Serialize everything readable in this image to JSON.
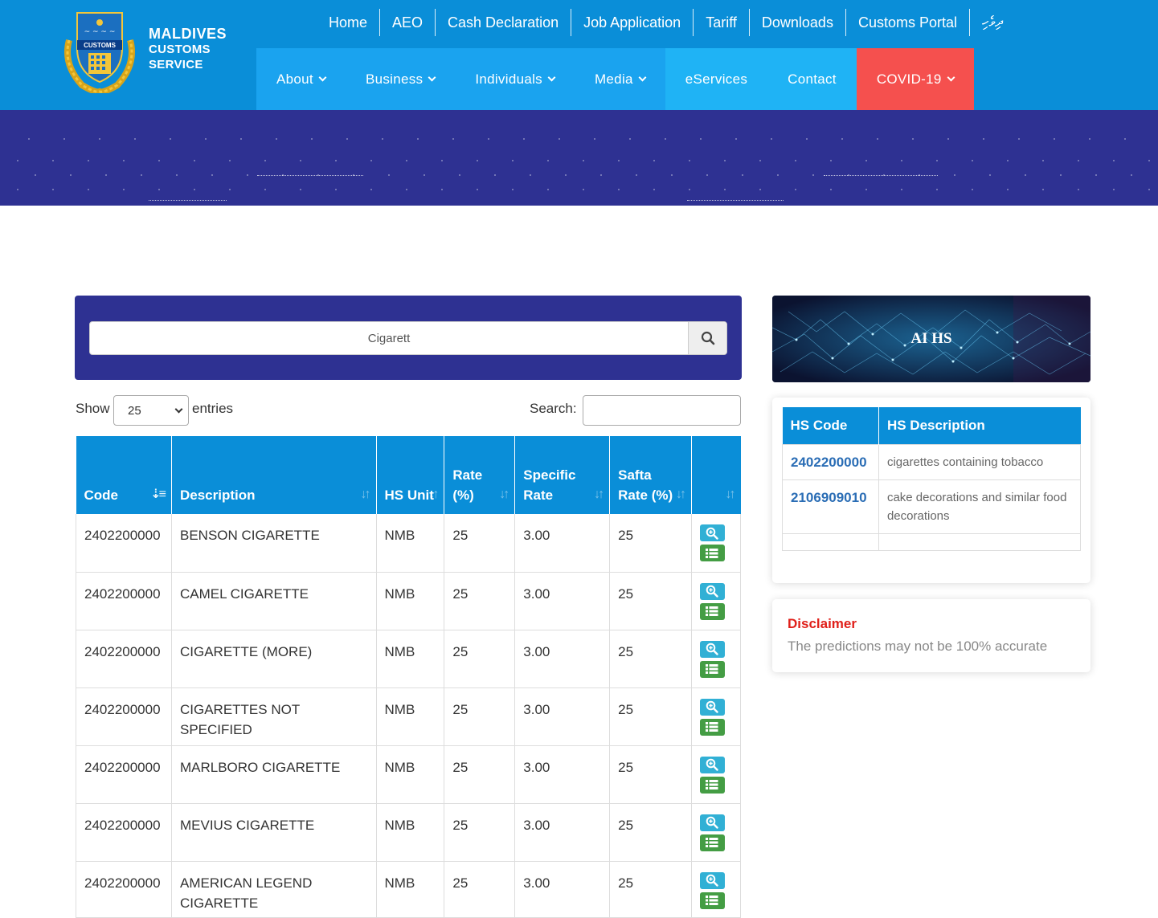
{
  "logo": {
    "line1": "MALDIVES",
    "line2": "CUSTOMS",
    "line3": "SERVICE",
    "badge_text": "CUSTOMS"
  },
  "top_nav": [
    "Home",
    "AEO",
    "Cash Declaration",
    "Job Application",
    "Tariff",
    "Downloads",
    "Customs Portal"
  ],
  "language_link": "ދިވެހި",
  "main_nav": [
    {
      "label": "About",
      "dropdown": true
    },
    {
      "label": "Business",
      "dropdown": true
    },
    {
      "label": "Individuals",
      "dropdown": true
    },
    {
      "label": "Media",
      "dropdown": true
    },
    {
      "label": "eServices",
      "dropdown": false
    },
    {
      "label": "Contact",
      "dropdown": false
    },
    {
      "label": "COVID-19",
      "dropdown": true
    }
  ],
  "search": {
    "value": "Cigarett",
    "icon": "search-icon"
  },
  "controls": {
    "show_label": "Show",
    "page_size": "25",
    "entries_label": "entries",
    "search_label": "Search:"
  },
  "table": {
    "headers": [
      "Code",
      "Description",
      "HS Unit",
      "Rate (%)",
      "Specific Rate",
      "Safta Rate (%)",
      ""
    ],
    "rows": [
      {
        "code": "2402200000",
        "description": "BENSON CIGARETTE",
        "unit": "NMB",
        "rate": "25",
        "specific": "3.00",
        "safta": "25"
      },
      {
        "code": "2402200000",
        "description": "CAMEL CIGARETTE",
        "unit": "NMB",
        "rate": "25",
        "specific": "3.00",
        "safta": "25"
      },
      {
        "code": "2402200000",
        "description": "CIGARETTE (MORE)",
        "unit": "NMB",
        "rate": "25",
        "specific": "3.00",
        "safta": "25"
      },
      {
        "code": "2402200000",
        "description": "CIGARETTES NOT SPECIFIED",
        "unit": "NMB",
        "rate": "25",
        "specific": "3.00",
        "safta": "25"
      },
      {
        "code": "2402200000",
        "description": "MARLBORO CIGARETTE",
        "unit": "NMB",
        "rate": "25",
        "specific": "3.00",
        "safta": "25"
      },
      {
        "code": "2402200000",
        "description": "MEVIUS CIGARETTE",
        "unit": "NMB",
        "rate": "25",
        "specific": "3.00",
        "safta": "25"
      },
      {
        "code": "2402200000",
        "description": "AMERICAN LEGEND CIGARETTE",
        "unit": "NMB",
        "rate": "25",
        "specific": "3.00",
        "safta": "25"
      }
    ]
  },
  "ai_hs": {
    "title": "AI HS",
    "headers": [
      "HS Code",
      "HS Description"
    ],
    "rows": [
      {
        "code": "2402200000",
        "description": "cigarettes containing tobacco"
      },
      {
        "code": "2106909010",
        "description": "cake decorations and similar food decorations"
      }
    ]
  },
  "disclaimer": {
    "title": "Disclaimer",
    "text": "The predictions may not be 100% accurate"
  },
  "colors": {
    "header_blue": "#0a8ed8",
    "nav_blue": "#1aa3ef",
    "covid_red": "#f5504e",
    "banner_indigo": "#2e3192",
    "zoom_btn": "#31b0d5",
    "list_btn": "#449d44",
    "disclaimer_red": "#e0201a"
  }
}
